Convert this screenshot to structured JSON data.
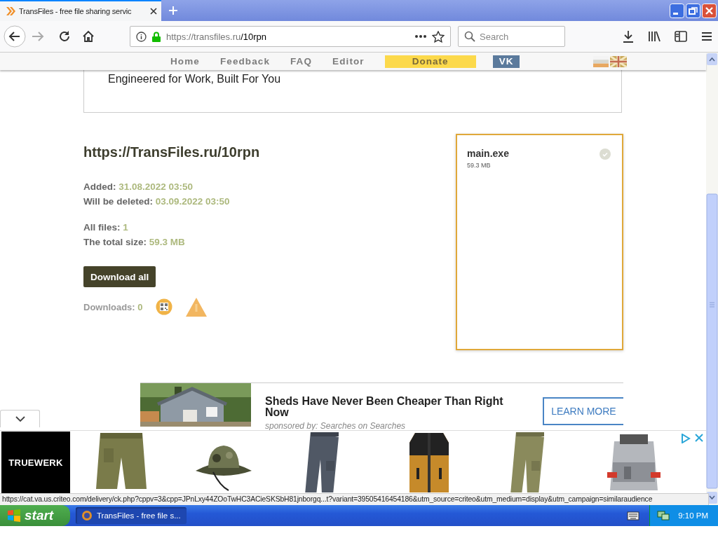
{
  "browser": {
    "tabs": [
      {
        "title": "TransFiles - free file sharing servic",
        "selected": true
      }
    ],
    "url_host": "https://transfiles.ru",
    "url_path": "/10rpn",
    "search_placeholder": "Search"
  },
  "site_nav": {
    "items": [
      {
        "label": "Home",
        "kind": "link"
      },
      {
        "label": "Feedback",
        "kind": "link"
      },
      {
        "label": "FAQ",
        "kind": "link"
      },
      {
        "label": "Editor",
        "kind": "link"
      },
      {
        "label": "Donate",
        "kind": "donate"
      },
      {
        "label": "VK",
        "kind": "vk"
      }
    ]
  },
  "top_ad": {
    "tagline": "Engineered for Work, Built For You"
  },
  "share": {
    "link": "https://TransFiles.ru/10rpn",
    "dates": [
      {
        "label": "Added:",
        "value": "31.08.2022 03:50"
      },
      {
        "label": "Will be deleted:",
        "value": "03.09.2022 03:50"
      }
    ],
    "stats": [
      {
        "label": "All files:",
        "value": "1"
      },
      {
        "label": "The total size:",
        "value": "59.3 MB"
      }
    ],
    "button": "Download all",
    "downloads_label": "Downloads:",
    "downloads_value": "0"
  },
  "files": [
    {
      "name": "main.exe",
      "size": "59.3 MB"
    }
  ],
  "ad": {
    "headline": "Sheds Have Never Been Cheaper Than Right Now",
    "sponsor": "sponsored by: Searches on Searches",
    "cta": "LEARN MORE"
  },
  "bottom_ad": {
    "brand": "TRUEWERK"
  },
  "status_url": "https://cat.va.us.criteo.com/delivery/ck.php?cppv=3&cpp=JPnLxy44ZOoTwHC3ACieSKSbH81jnborgq...t?variant=39505416454186&utm_source=criteo&utm_medium=display&utm_campaign=similaraudience",
  "taskbar": {
    "start": "start",
    "tasks": [
      {
        "label": "TransFiles - free file s...",
        "selected": true
      }
    ],
    "clock": "9:10 PM"
  }
}
